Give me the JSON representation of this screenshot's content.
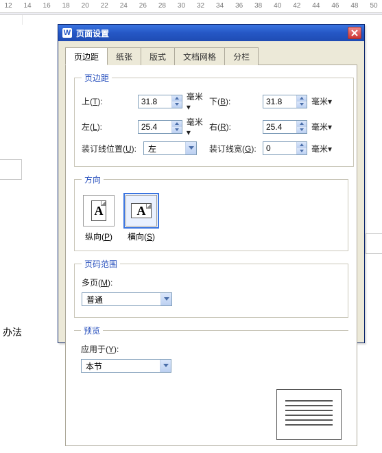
{
  "ruler": {
    "start": 12,
    "end": 50,
    "step": 2
  },
  "background_text": "办法",
  "dialog": {
    "title": "页面设置",
    "app_icon_letter": "W",
    "tabs": [
      "页边距",
      "纸张",
      "版式",
      "文档网格",
      "分栏"
    ],
    "active_tab": 0,
    "margins_group": {
      "legend": "页边距",
      "top": {
        "label": "上(",
        "hot": "T",
        "label2": "):",
        "value": "31.8",
        "unit_label": "毫米",
        "unit_arrow": true
      },
      "bottom": {
        "label": "下(",
        "hot": "B",
        "label2": "):",
        "value": "31.8",
        "unit_label": "毫米",
        "unit_arrow": true
      },
      "left": {
        "label": "左(",
        "hot": "L",
        "label2": "):",
        "value": "25.4",
        "unit_label": "毫米",
        "unit_arrow": true
      },
      "right": {
        "label": "右(",
        "hot": "R",
        "label2": "):",
        "value": "25.4",
        "unit_label": "毫米",
        "unit_arrow": true
      },
      "gutter_pos": {
        "label": "装订线位置(",
        "hot": "U",
        "label2": "):",
        "value": "左"
      },
      "gutter_w": {
        "label": "装订线宽(",
        "hot": "G",
        "label2": "):",
        "value": "0",
        "unit_label": "毫米",
        "unit_arrow": true
      }
    },
    "orientation_group": {
      "legend": "方向",
      "portrait": {
        "label": "纵向(",
        "hot": "P",
        "label2": ")"
      },
      "landscape": {
        "label": "横向(",
        "hot": "S",
        "label2": ")"
      },
      "selected": "landscape"
    },
    "pages_group": {
      "legend": "页码范围",
      "multi": {
        "label": "多页(",
        "hot": "M",
        "label2": "):",
        "value": "普通"
      }
    },
    "preview_group": {
      "legend": "预览",
      "apply": {
        "label": "应用于(",
        "hot": "Y",
        "label2": "):",
        "value": "本节"
      }
    }
  }
}
